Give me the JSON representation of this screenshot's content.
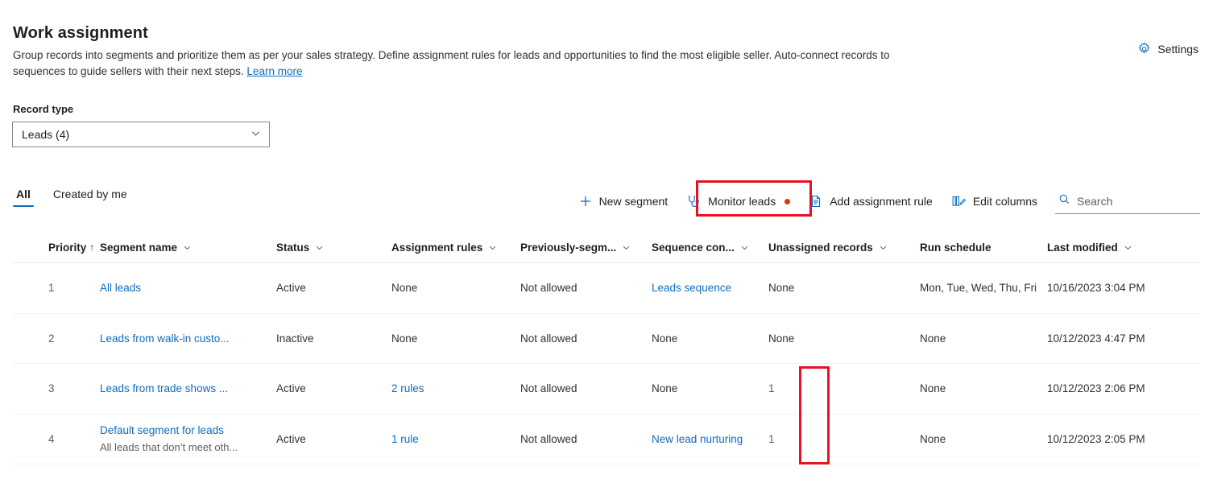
{
  "header": {
    "title": "Work assignment",
    "description_part1": "Group records into segments and prioritize them as per your sales strategy. Define assignment rules for leads and opportunities to find the most eligible seller. Auto-connect records to sequences to guide sellers with their next steps. ",
    "learn_more": "Learn more",
    "settings_label": "Settings",
    "settings_icon": "gear-icon"
  },
  "record_type": {
    "label": "Record type",
    "value": "Leads (4)",
    "chevron_icon": "chevron-down-icon"
  },
  "tabs": [
    {
      "label": "All",
      "selected": true
    },
    {
      "label": "Created by me",
      "selected": false
    }
  ],
  "commandbar": {
    "new_segment": {
      "label": "New segment",
      "icon": "plus-icon"
    },
    "monitor_leads": {
      "label": "Monitor leads",
      "icon": "stethoscope-icon",
      "badge_dot": true,
      "highlighted": true
    },
    "add_assignment_rule": {
      "label": "Add assignment rule",
      "icon": "document-icon"
    },
    "edit_columns": {
      "label": "Edit columns",
      "icon": "edit-columns-icon"
    },
    "search": {
      "placeholder": "Search",
      "value": "",
      "icon": "search-icon"
    }
  },
  "table": {
    "columns": [
      {
        "label": "Priority",
        "sort": "↑",
        "menu": true
      },
      {
        "label": "Segment name",
        "menu": true
      },
      {
        "label": "Status",
        "menu": true
      },
      {
        "label": "Assignment rules",
        "menu": true
      },
      {
        "label": "Previously-segm...",
        "menu": true
      },
      {
        "label": "Sequence con...",
        "menu": true
      },
      {
        "label": "Unassigned records",
        "menu": true
      },
      {
        "label": "Run schedule",
        "menu": false
      },
      {
        "label": "Last modified",
        "menu": true
      }
    ],
    "rows": [
      {
        "priority": "1",
        "segment_name": "All leads",
        "segment_sub": "",
        "status": "Active",
        "assignment_rules": "None",
        "assignment_rules_link": false,
        "previously_segmented": "Not allowed",
        "sequence_connected": "Leads sequence",
        "sequence_connected_link": true,
        "unassigned_records": "None",
        "run_schedule": "Mon, Tue, Wed, Thu, Fri",
        "last_modified": "10/16/2023 3:04 PM"
      },
      {
        "priority": "2",
        "segment_name": "Leads from walk-in custo...",
        "segment_sub": "",
        "status": "Inactive",
        "assignment_rules": "None",
        "assignment_rules_link": false,
        "previously_segmented": "Not allowed",
        "sequence_connected": "None",
        "sequence_connected_link": false,
        "unassigned_records": "None",
        "run_schedule": "None",
        "last_modified": "10/12/2023 4:47 PM"
      },
      {
        "priority": "3",
        "segment_name": "Leads from trade shows ...",
        "segment_sub": "",
        "status": "Active",
        "assignment_rules": "2 rules",
        "assignment_rules_link": true,
        "previously_segmented": "Not allowed",
        "sequence_connected": "None",
        "sequence_connected_link": false,
        "unassigned_records": "1",
        "run_schedule": "None",
        "last_modified": "10/12/2023 2:06 PM"
      },
      {
        "priority": "4",
        "segment_name": "Default segment for leads",
        "segment_sub": "All leads that don’t meet oth...",
        "status": "Active",
        "assignment_rules": "1 rule",
        "assignment_rules_link": true,
        "previously_segmented": "Not allowed",
        "sequence_connected": "New lead nurturing",
        "sequence_connected_link": true,
        "unassigned_records": "1",
        "run_schedule": "None",
        "last_modified": "10/12/2023 2:05 PM"
      }
    ]
  },
  "colors": {
    "link": "#0f6cbd",
    "accent": "#0f6cbd",
    "highlight_box": "#e81123",
    "badge_dot": "#d83b01"
  }
}
